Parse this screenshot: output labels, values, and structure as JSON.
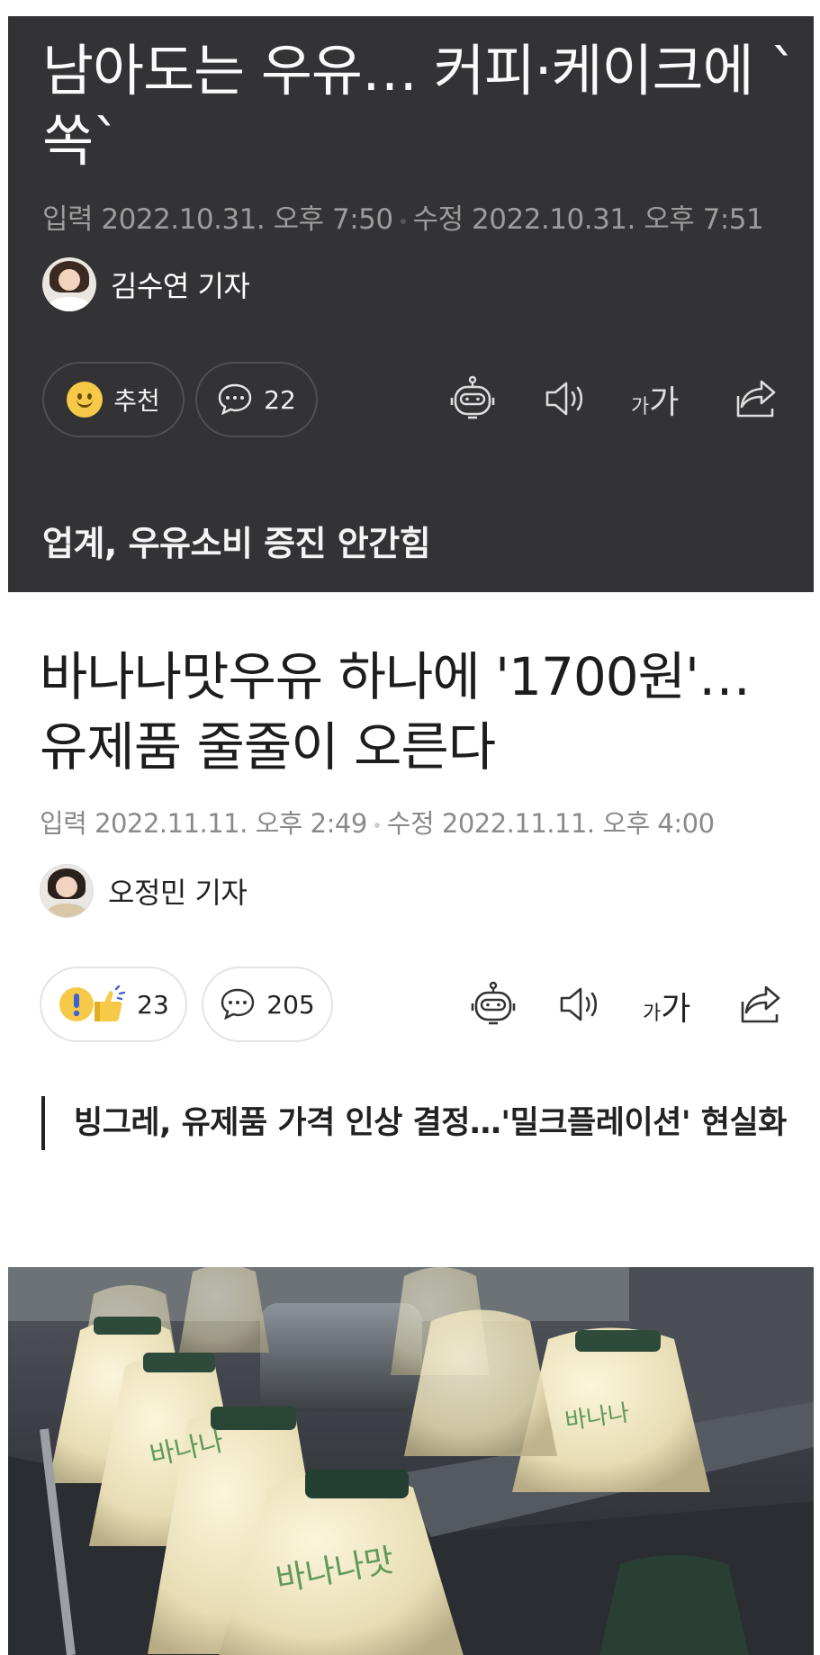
{
  "card1": {
    "title": "남아도는 우유… 커피·케이크에 `쏙`",
    "published_label": "입력",
    "published": "2022.10.31. 오후 7:50",
    "modified_label": "수정",
    "modified": "2022.10.31. 오후 7:51",
    "author": "김수연 기자",
    "reaction_label": "추천",
    "comment_count": "22",
    "font_size_small": "가",
    "font_size_large": "가",
    "subhead": "업계, 우유소비 증진 안간힘"
  },
  "article": {
    "title": "바나나맛우유 하나에 '1700원'… 유제품 줄줄이 오른다",
    "published_label": "입력",
    "published": "2022.11.11. 오후 2:49",
    "modified_label": "수정",
    "modified": "2022.11.11. 오후 4:00",
    "author": "오정민 기자",
    "reaction_count": "23",
    "comment_count": "205",
    "font_size_small": "가",
    "font_size_large": "가",
    "subhead": "빙그레, 유제품 가격 인상 결정…'밀크플레이션' 현실화"
  },
  "icons": [
    "smile-icon",
    "comment-icon",
    "summary-bot-icon",
    "speaker-icon",
    "font-size-icon",
    "share-icon",
    "surprise-icon",
    "thumbs-up-icon"
  ],
  "colors": {
    "dark_bg": "#333335",
    "smiley": "#f7c948",
    "text_dark": "#1d1d1d",
    "meta_gray": "#8a8a8a"
  }
}
